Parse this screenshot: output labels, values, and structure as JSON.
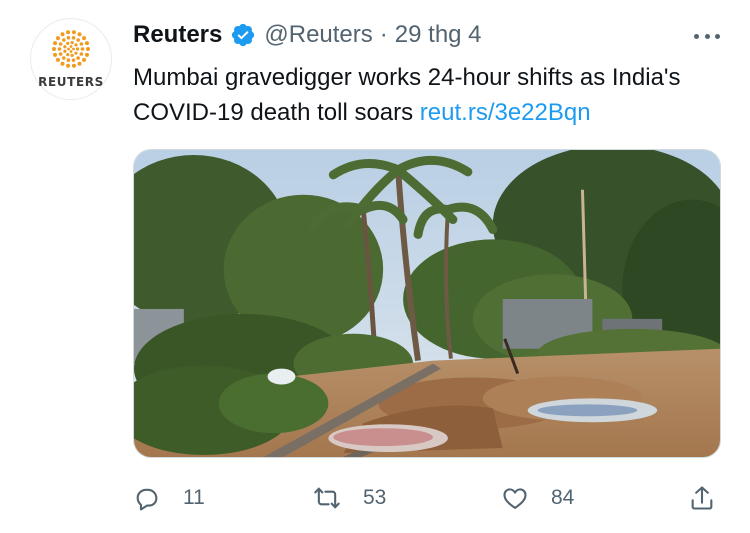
{
  "tweet": {
    "author": {
      "display_name": "Reuters",
      "handle": "@Reuters",
      "avatar_text": "REUTERS",
      "verified": true
    },
    "separator": "·",
    "date": "29 thg 4",
    "text_before_link": "Mumbai gravedigger works 24-hour shifts as India's COVID-19 death toll soars ",
    "link_text": "reut.rs/3e22Bqn",
    "media": {
      "type": "photo",
      "subject": "graveyard with palm trees and freshly dug graves"
    },
    "actions": {
      "reply": {
        "icon": "reply-icon",
        "count": "11"
      },
      "retweet": {
        "icon": "retweet-icon",
        "count": "53"
      },
      "like": {
        "icon": "heart-icon",
        "count": "84"
      },
      "share": {
        "icon": "share-icon"
      }
    }
  },
  "colors": {
    "link": "#1d9bf0",
    "verified": "#1d9bf0",
    "secondary_text": "#536471",
    "brand_orange": "#f29a1e"
  }
}
